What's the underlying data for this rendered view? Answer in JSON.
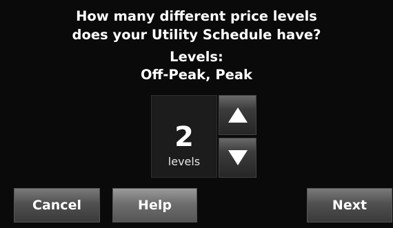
{
  "question": {
    "line1": "How many different price levels",
    "line2": "does your Utility Schedule have?"
  },
  "levels_info": {
    "heading": "Levels:",
    "list": "Off-Peak, Peak"
  },
  "stepper": {
    "value": "2",
    "unit": "levels",
    "up_icon": "up-triangle",
    "down_icon": "down-triangle"
  },
  "buttons": {
    "cancel": "Cancel",
    "help": "Help",
    "next": "Next"
  },
  "colors": {
    "background": "#0a0a0a",
    "text": "#ffffff",
    "button": "#505050"
  }
}
